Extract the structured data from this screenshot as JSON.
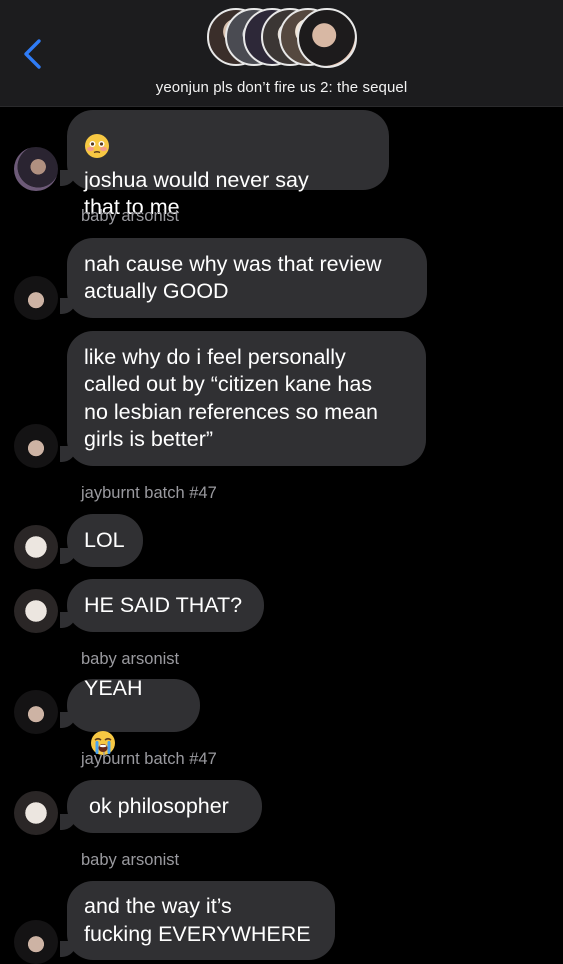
{
  "header": {
    "title": "yeonjun pls don’t fire us 2: the sequel",
    "back_icon": "chevron-left-icon",
    "accent_color": "#2f7cf6"
  },
  "messages": [
    {
      "sender_label": "",
      "emoji": "flushed-face-emoji",
      "text": "joshua would never say\nthat to me"
    },
    {
      "sender_label": "baby arsonist",
      "text": "nah cause why was that review\nactually GOOD"
    },
    {
      "sender_label": "",
      "text": "like why do i feel personally\ncalled out by “citizen kane has\nno lesbian references so mean\ngirls is better”"
    },
    {
      "sender_label": "jayburnt batch #47",
      "text": "LOL"
    },
    {
      "sender_label": "",
      "text": "HE SAID THAT?"
    },
    {
      "sender_label": "baby arsonist",
      "text": "YEAH",
      "emoji": "loudly-crying-face-emoji"
    },
    {
      "sender_label": "jayburnt batch #47",
      "text": "ok philosopher"
    },
    {
      "sender_label": "baby arsonist",
      "text": "and the way it’s\nfucking EVERYWHERE"
    }
  ]
}
